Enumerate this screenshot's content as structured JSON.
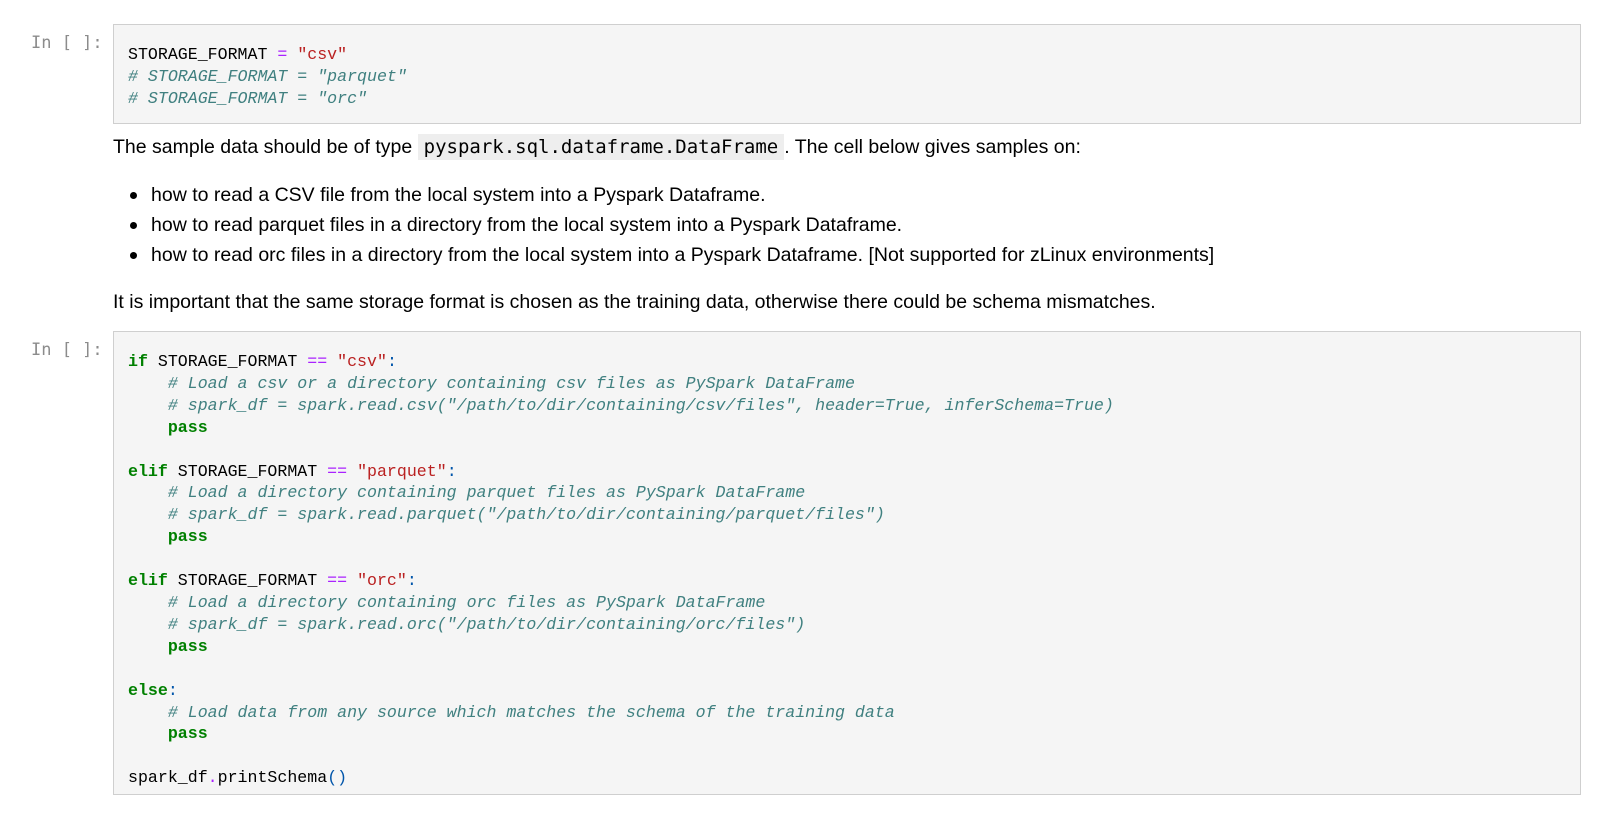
{
  "cell1": {
    "prompt": "In [ ]:",
    "lines": [
      [
        {
          "t": "STORAGE_FORMAT ",
          "c": ""
        },
        {
          "t": "=",
          "c": "op"
        },
        {
          "t": " ",
          "c": ""
        },
        {
          "t": "\"csv\"",
          "c": "str"
        }
      ],
      [
        {
          "t": "# STORAGE_FORMAT = \"parquet\"",
          "c": "cm"
        }
      ],
      [
        {
          "t": "# STORAGE_FORMAT = \"orc\"",
          "c": "cm"
        }
      ]
    ]
  },
  "markdown": {
    "intro_before": "The sample data should be of type ",
    "intro_code": "pyspark.sql.dataframe.DataFrame",
    "intro_after": ". The cell below gives samples on:",
    "bullets": [
      "how to read a CSV file from the local system into a Pyspark Dataframe.",
      "how to read parquet files in a directory from the local system into a Pyspark Dataframe.",
      "how to read orc files in a directory from the local system into a Pyspark Dataframe. [Not supported for zLinux environments]"
    ],
    "closing": "It is important that the same storage format is chosen as the training data, otherwise there could be schema mismatches."
  },
  "cell2": {
    "prompt": "In [ ]:",
    "lines": [
      [
        {
          "t": "if",
          "c": "kw"
        },
        {
          "t": " STORAGE_FORMAT ",
          "c": ""
        },
        {
          "t": "==",
          "c": "op"
        },
        {
          "t": " ",
          "c": ""
        },
        {
          "t": "\"csv\"",
          "c": "str"
        },
        {
          "t": ":",
          "c": "punc"
        }
      ],
      [
        {
          "t": "    ",
          "c": ""
        },
        {
          "t": "# Load a csv or a directory containing csv files as PySpark DataFrame",
          "c": "cm"
        }
      ],
      [
        {
          "t": "    ",
          "c": ""
        },
        {
          "t": "# spark_df = spark.read.csv(\"/path/to/dir/containing/csv/files\", header=True, inferSchema=True)",
          "c": "cm"
        }
      ],
      [
        {
          "t": "    ",
          "c": ""
        },
        {
          "t": "pass",
          "c": "kw"
        }
      ],
      [],
      [
        {
          "t": "elif",
          "c": "kw"
        },
        {
          "t": " STORAGE_FORMAT ",
          "c": ""
        },
        {
          "t": "==",
          "c": "op"
        },
        {
          "t": " ",
          "c": ""
        },
        {
          "t": "\"parquet\"",
          "c": "str"
        },
        {
          "t": ":",
          "c": "punc"
        }
      ],
      [
        {
          "t": "    ",
          "c": ""
        },
        {
          "t": "# Load a directory containing parquet files as PySpark DataFrame",
          "c": "cm"
        }
      ],
      [
        {
          "t": "    ",
          "c": ""
        },
        {
          "t": "# spark_df = spark.read.parquet(\"/path/to/dir/containing/parquet/files\")",
          "c": "cm"
        }
      ],
      [
        {
          "t": "    ",
          "c": ""
        },
        {
          "t": "pass",
          "c": "kw"
        }
      ],
      [],
      [
        {
          "t": "elif",
          "c": "kw"
        },
        {
          "t": " STORAGE_FORMAT ",
          "c": ""
        },
        {
          "t": "==",
          "c": "op"
        },
        {
          "t": " ",
          "c": ""
        },
        {
          "t": "\"orc\"",
          "c": "str"
        },
        {
          "t": ":",
          "c": "punc"
        }
      ],
      [
        {
          "t": "    ",
          "c": ""
        },
        {
          "t": "# Load a directory containing orc files as PySpark DataFrame",
          "c": "cm"
        }
      ],
      [
        {
          "t": "    ",
          "c": ""
        },
        {
          "t": "# spark_df = spark.read.orc(\"/path/to/dir/containing/orc/files\")",
          "c": "cm"
        }
      ],
      [
        {
          "t": "    ",
          "c": ""
        },
        {
          "t": "pass",
          "c": "kw"
        }
      ],
      [],
      [
        {
          "t": "else",
          "c": "kw"
        },
        {
          "t": ":",
          "c": "punc"
        }
      ],
      [
        {
          "t": "    ",
          "c": ""
        },
        {
          "t": "# Load data from any source which matches the schema of the training data",
          "c": "cm"
        }
      ],
      [
        {
          "t": "    ",
          "c": ""
        },
        {
          "t": "pass",
          "c": "kw"
        }
      ],
      [],
      [
        {
          "t": "spark_df",
          "c": ""
        },
        {
          "t": ".",
          "c": "op"
        },
        {
          "t": "printSchema",
          "c": ""
        },
        {
          "t": "()",
          "c": "punc"
        }
      ]
    ]
  },
  "colors": {
    "keyword": "#008000",
    "operator": "#aa22ff",
    "string": "#ba2121",
    "comment": "#408080",
    "punctuation": "#0055aa",
    "prompt": "#8c8c8c",
    "cell_background": "#f5f5f5",
    "cell_border": "#cfcfcf"
  }
}
